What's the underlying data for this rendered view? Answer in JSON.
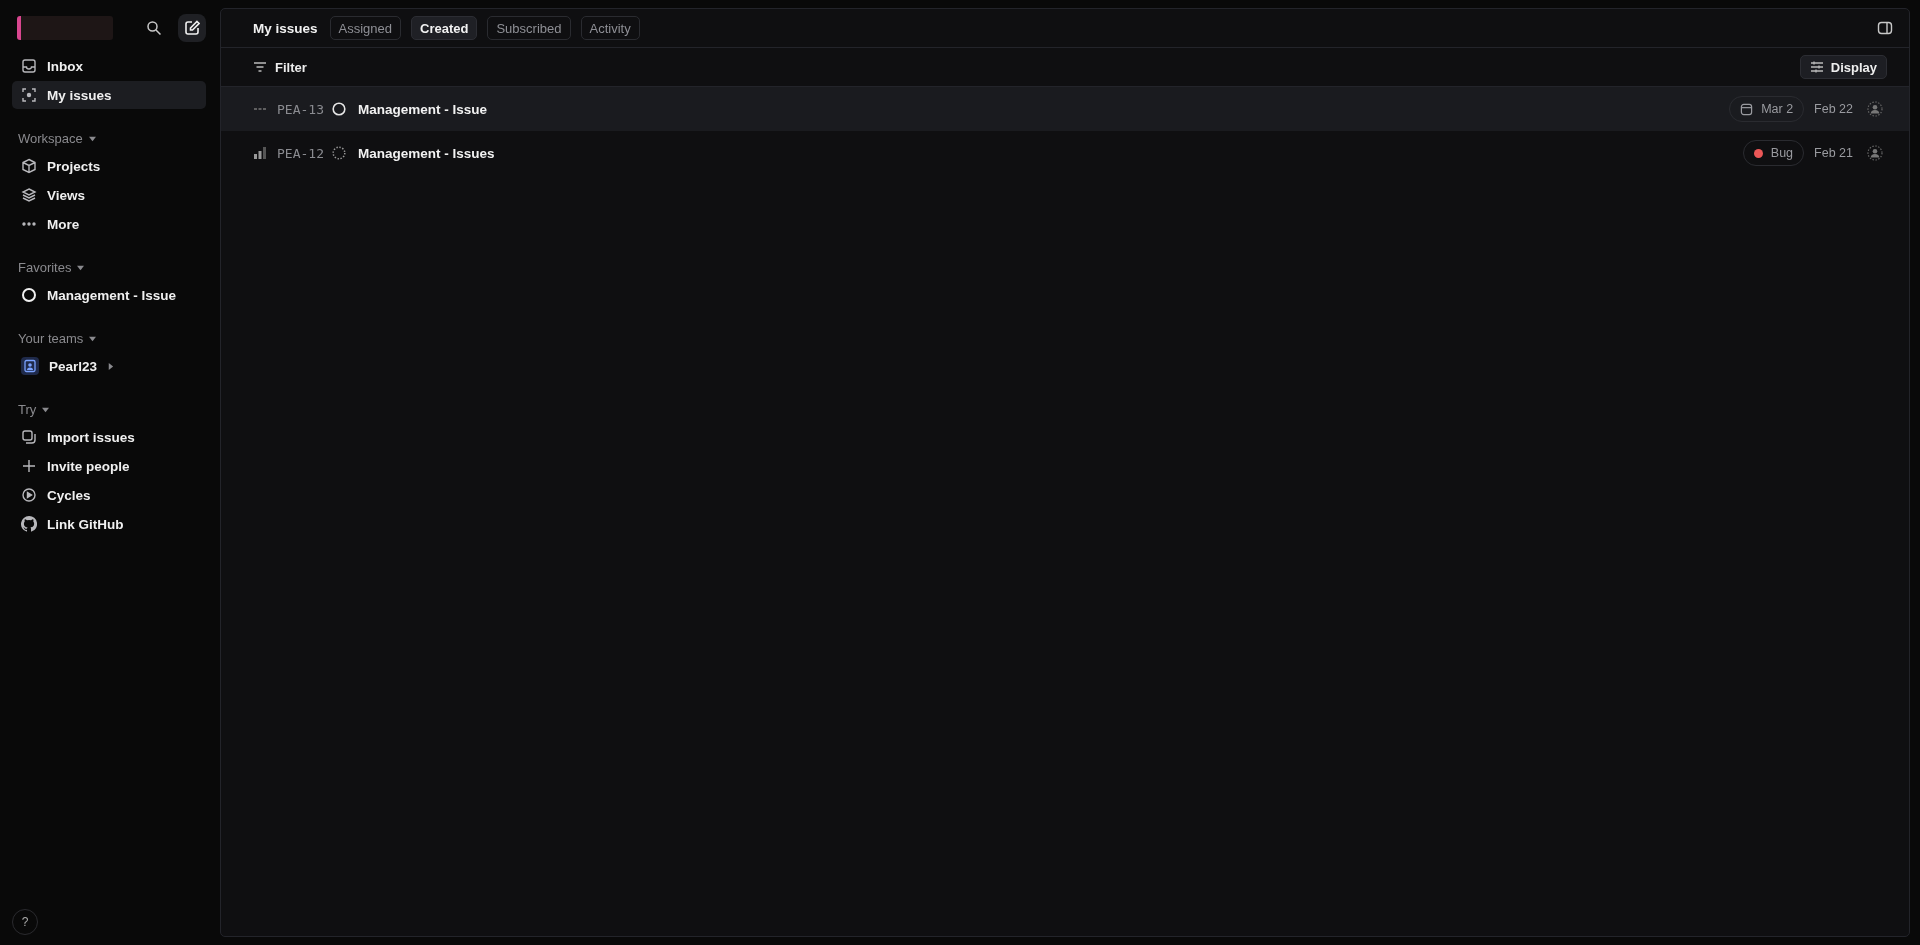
{
  "sidebar": {
    "nav": [
      {
        "label": "Inbox",
        "selected": false
      },
      {
        "label": "My issues",
        "selected": true
      }
    ],
    "sections": [
      {
        "title": "Workspace",
        "items": [
          {
            "label": "Projects"
          },
          {
            "label": "Views"
          },
          {
            "label": "More"
          }
        ]
      },
      {
        "title": "Favorites",
        "items": [
          {
            "label": "Management - Issue"
          }
        ]
      },
      {
        "title": "Your teams",
        "items": [
          {
            "label": "Pearl23",
            "collapsed": true
          }
        ]
      },
      {
        "title": "Try",
        "items": [
          {
            "label": "Import issues"
          },
          {
            "label": "Invite people"
          },
          {
            "label": "Cycles"
          },
          {
            "label": "Link GitHub"
          }
        ]
      }
    ],
    "help": "?"
  },
  "header": {
    "title": "My issues",
    "tabs": [
      {
        "label": "Assigned",
        "selected": false
      },
      {
        "label": "Created",
        "selected": true
      },
      {
        "label": "Subscribed",
        "selected": false
      },
      {
        "label": "Activity",
        "selected": false
      }
    ]
  },
  "toolbar": {
    "filter": "Filter",
    "display": "Display"
  },
  "issues": [
    {
      "id": "PEA-13",
      "title": "Management - Issue",
      "selected": true,
      "tag": {
        "kind": "due_date",
        "label": "Mar 2"
      },
      "date": "Feb 22"
    },
    {
      "id": "PEA-12",
      "title": "Management - Issues",
      "selected": false,
      "tag": {
        "kind": "label",
        "label": "Bug",
        "color": "#eb5757"
      },
      "date": "Feb 21"
    }
  ]
}
